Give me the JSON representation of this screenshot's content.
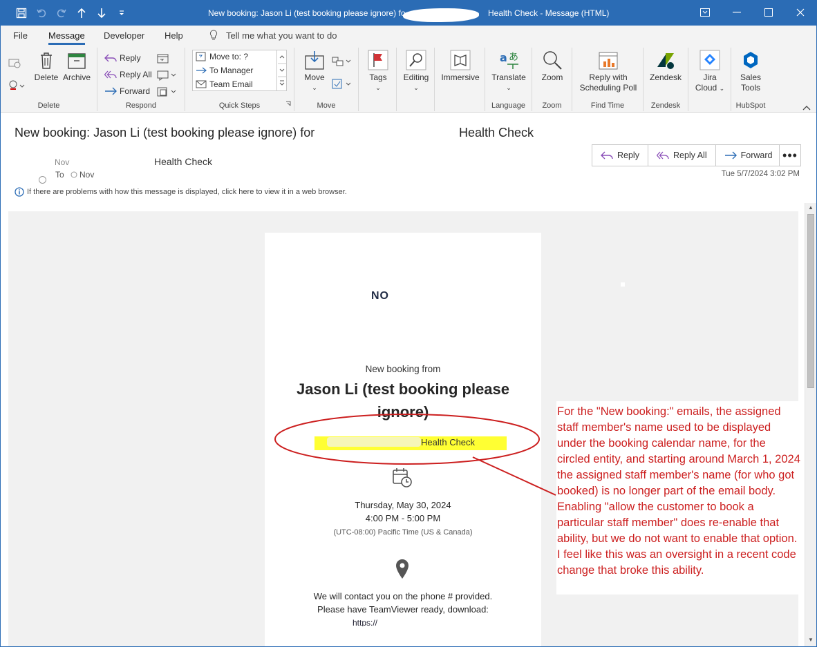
{
  "window": {
    "title": "New booking: Jason Li (test booking please ignore) fo",
    "title_suffix": "Health Check  -  Message (HTML)"
  },
  "menu": {
    "tabs": [
      "File",
      "Message",
      "Developer",
      "Help"
    ],
    "tell_me": "Tell me what you want to do"
  },
  "ribbon": {
    "delete_group": {
      "delete": "Delete",
      "archive": "Archive",
      "label": "Delete"
    },
    "respond_group": {
      "reply": "Reply",
      "reply_all": "Reply All",
      "forward": "Forward",
      "label": "Respond"
    },
    "quick_steps": {
      "items": [
        "Move to: ?",
        "To Manager",
        "Team Email"
      ],
      "label": "Quick Steps"
    },
    "move_group": {
      "move": "Move",
      "label": "Move"
    },
    "tags": "Tags",
    "editing": "Editing",
    "immersive": "Immersive",
    "language_group": {
      "translate": "Translate",
      "label": "Language"
    },
    "zoom_group": {
      "zoom": "Zoom",
      "label": "Zoom"
    },
    "find_time_group": {
      "reply_poll_line1": "Reply with",
      "reply_poll_line2": "Scheduling Poll",
      "label": "Find Time"
    },
    "zendesk_group": {
      "zendesk": "Zendesk",
      "label": "Zendesk"
    },
    "jira": {
      "line1": "Jira",
      "line2": "Cloud"
    },
    "hubspot_group": {
      "line1": "Sales",
      "line2": "Tools",
      "label": "HubSpot"
    }
  },
  "message": {
    "subject": "New booking: Jason Li (test booking please ignore) for",
    "subject_end": "Health Check",
    "sender_faded": "Nov",
    "sender_health": "Health Check",
    "to_label": "To",
    "to_value": "Nov",
    "date": "Tue 5/7/2024 3:02 PM",
    "actions": {
      "reply": "Reply",
      "reply_all": "Reply All",
      "forward": "Forward",
      "more": "•••"
    },
    "info_bar": "If there are problems with how this message is displayed, click here to view it in a web browser."
  },
  "email_body": {
    "logo_text": "NO",
    "new_booking_from": "New booking from",
    "customer_name": "Jason Li (test booking please ignore)",
    "calendar_name": "Health Check",
    "date": "Thursday, May 30, 2024",
    "time": "4:00 PM - 5:00 PM",
    "timezone": "(UTC-08:00) Pacific Time (US & Canada)",
    "contact_line1": "We will contact you on the phone # provided.",
    "contact_line2": "Please have TeamViewer ready, download:",
    "download_link": "https://"
  },
  "annotation": {
    "text": "For the \"New booking:\" emails, the assigned staff member's name used to be displayed under the booking calendar name, for the circled entity, and starting around March 1, 2024 the assigned staff member's name (for who got booked) is no longer part of the email body. Enabling \"allow the customer to book a particular staff member\" does re-enable that ability, but we do not want to enable that option. I feel like this was an oversight in a recent code change that broke this ability.",
    "color": "#cc1f1f"
  },
  "colors": {
    "accent": "#2b6cb5",
    "highlight": "#ffff33",
    "annotation": "#cc1f1f"
  }
}
